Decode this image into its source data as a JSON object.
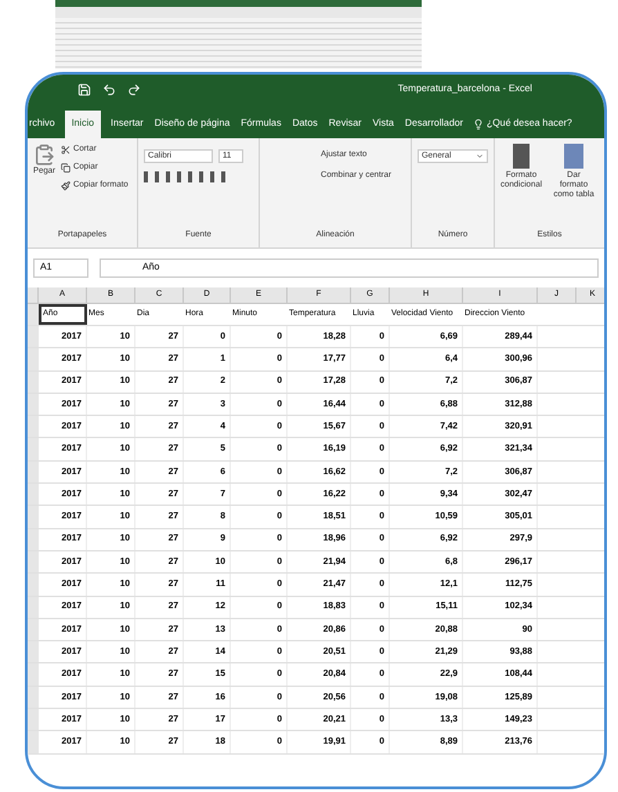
{
  "window": {
    "title": "Temperatura_barcelona - Excel"
  },
  "tabs": [
    {
      "label": "rchivo",
      "selected": false
    },
    {
      "label": "Inicio",
      "selected": true
    },
    {
      "label": "Insertar",
      "selected": false
    },
    {
      "label": "Diseño de página",
      "selected": false
    },
    {
      "label": "Fórmulas",
      "selected": false
    },
    {
      "label": "Datos",
      "selected": false
    },
    {
      "label": "Revisar",
      "selected": false
    },
    {
      "label": "Vista",
      "selected": false
    },
    {
      "label": "Desarrollador",
      "selected": false
    }
  ],
  "tell_me": "¿Qué desea hacer?",
  "ribbon": {
    "clipboard": {
      "paste": "Pegar",
      "cut": "Cortar",
      "copy": "Copiar",
      "format_painter": "Copiar formato",
      "group": "Portapapeles"
    },
    "font": {
      "name": "Calibri",
      "size": "11",
      "group": "Fuente"
    },
    "alignment": {
      "wrap": "Ajustar texto",
      "merge": "Combinar y centrar",
      "group": "Alineación"
    },
    "number": {
      "format": "General",
      "group": "Número"
    },
    "styles": {
      "conditional": "Formato condicional",
      "table": "Dar formato como tabla",
      "group": "Estilos"
    }
  },
  "formula_bar": {
    "cell": "A1",
    "value": "Año"
  },
  "columns": [
    "A",
    "B",
    "C",
    "D",
    "E",
    "F",
    "G",
    "H",
    "I",
    "J",
    "K"
  ],
  "table": {
    "headers": [
      "Año",
      "Mes",
      "Dia",
      "Hora",
      "Minuto",
      "Temperatura",
      "Lluvia",
      "Velocidad Viento",
      "Direccion Viento"
    ],
    "rows": [
      [
        "2017",
        "10",
        "27",
        "0",
        "0",
        "18,28",
        "0",
        "6,69",
        "289,44"
      ],
      [
        "2017",
        "10",
        "27",
        "1",
        "0",
        "17,77",
        "0",
        "6,4",
        "300,96"
      ],
      [
        "2017",
        "10",
        "27",
        "2",
        "0",
        "17,28",
        "0",
        "7,2",
        "306,87"
      ],
      [
        "2017",
        "10",
        "27",
        "3",
        "0",
        "16,44",
        "0",
        "6,88",
        "312,88"
      ],
      [
        "2017",
        "10",
        "27",
        "4",
        "0",
        "15,67",
        "0",
        "7,42",
        "320,91"
      ],
      [
        "2017",
        "10",
        "27",
        "5",
        "0",
        "16,19",
        "0",
        "6,92",
        "321,34"
      ],
      [
        "2017",
        "10",
        "27",
        "6",
        "0",
        "16,62",
        "0",
        "7,2",
        "306,87"
      ],
      [
        "2017",
        "10",
        "27",
        "7",
        "0",
        "16,22",
        "0",
        "9,34",
        "302,47"
      ],
      [
        "2017",
        "10",
        "27",
        "8",
        "0",
        "18,51",
        "0",
        "10,59",
        "305,01"
      ],
      [
        "2017",
        "10",
        "27",
        "9",
        "0",
        "18,96",
        "0",
        "6,92",
        "297,9"
      ],
      [
        "2017",
        "10",
        "27",
        "10",
        "0",
        "21,94",
        "0",
        "6,8",
        "296,17"
      ],
      [
        "2017",
        "10",
        "27",
        "11",
        "0",
        "21,47",
        "0",
        "12,1",
        "112,75"
      ],
      [
        "2017",
        "10",
        "27",
        "12",
        "0",
        "18,83",
        "0",
        "15,11",
        "102,34"
      ],
      [
        "2017",
        "10",
        "27",
        "13",
        "0",
        "20,86",
        "0",
        "20,88",
        "90"
      ],
      [
        "2017",
        "10",
        "27",
        "14",
        "0",
        "20,51",
        "0",
        "21,29",
        "93,88"
      ],
      [
        "2017",
        "10",
        "27",
        "15",
        "0",
        "20,84",
        "0",
        "22,9",
        "108,44"
      ],
      [
        "2017",
        "10",
        "27",
        "16",
        "0",
        "20,56",
        "0",
        "19,08",
        "125,89"
      ],
      [
        "2017",
        "10",
        "27",
        "17",
        "0",
        "20,21",
        "0",
        "13,3",
        "149,23"
      ],
      [
        "2017",
        "10",
        "27",
        "18",
        "0",
        "19,91",
        "0",
        "8,89",
        "213,76"
      ]
    ]
  }
}
